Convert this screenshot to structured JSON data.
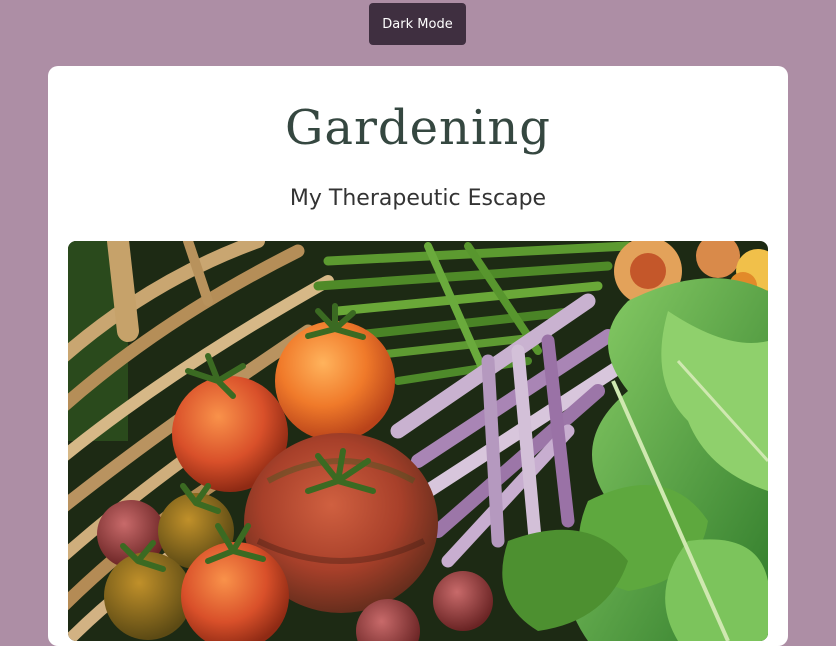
{
  "header": {
    "theme_toggle_label": "Dark Mode"
  },
  "main": {
    "title": "Gardening",
    "subtitle": "My Therapeutic Escape"
  },
  "colors": {
    "page_background": "#ad8ea5",
    "toggle_background": "#3f2f40",
    "card_background": "#ffffff",
    "title_color": "#354740"
  }
}
